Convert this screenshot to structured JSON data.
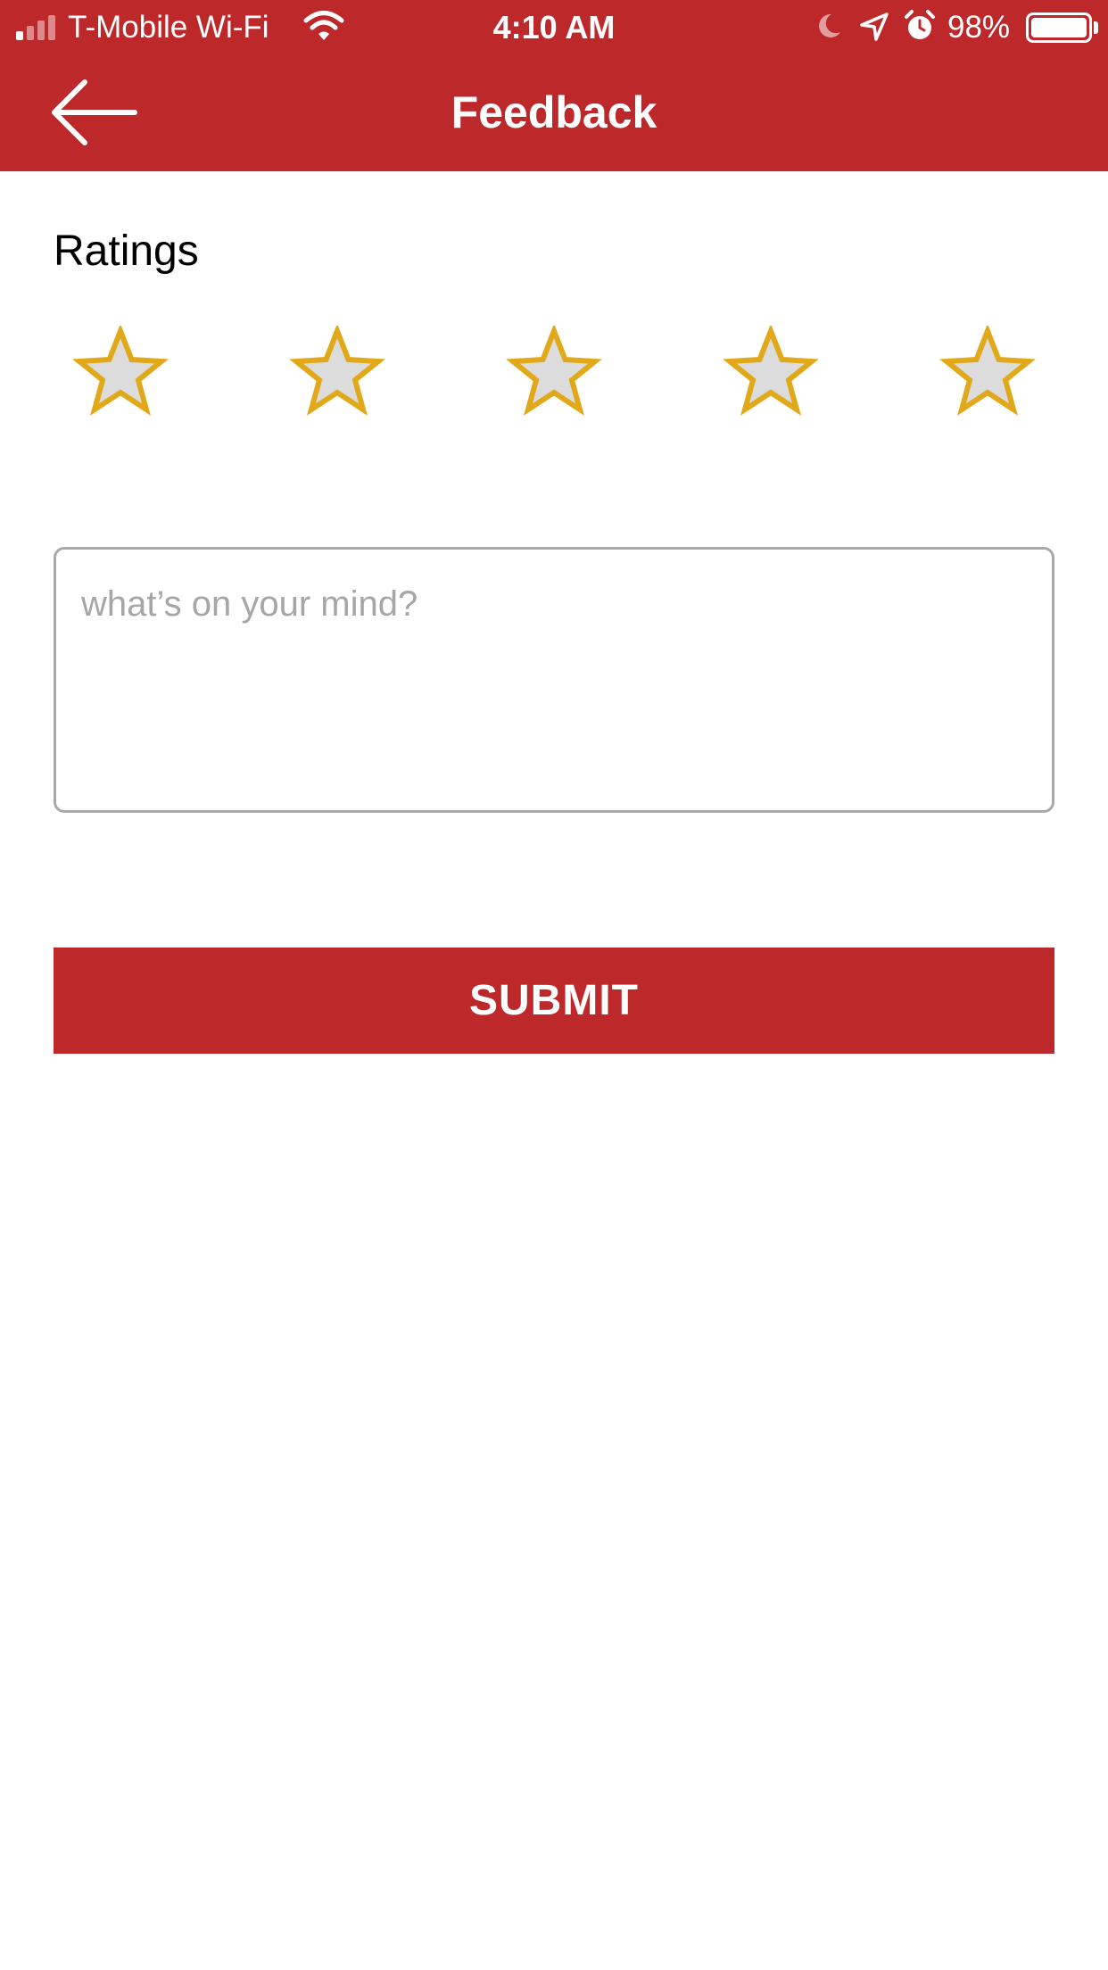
{
  "status_bar": {
    "carrier": "T-Mobile Wi-Fi",
    "time": "4:10 AM",
    "battery_percent": "98%",
    "battery_level": 0.98,
    "signal_bars_filled": 1,
    "signal_bars_total": 4,
    "icons": [
      "signal-icon",
      "wifi-icon",
      "moon-icon",
      "location-arrow-icon",
      "alarm-icon",
      "battery-icon"
    ]
  },
  "header": {
    "title": "Feedback",
    "back_icon": "arrow-left-icon",
    "background_color": "#bd282b"
  },
  "ratings": {
    "label": "Ratings",
    "max": 5,
    "selected": 0,
    "star_fill": "#dcdcdc",
    "star_outline": "#e1a91a"
  },
  "feedback": {
    "value": "",
    "placeholder": "what’s on your mind?"
  },
  "submit": {
    "label": "SUBMIT",
    "color": "#bd282b"
  }
}
